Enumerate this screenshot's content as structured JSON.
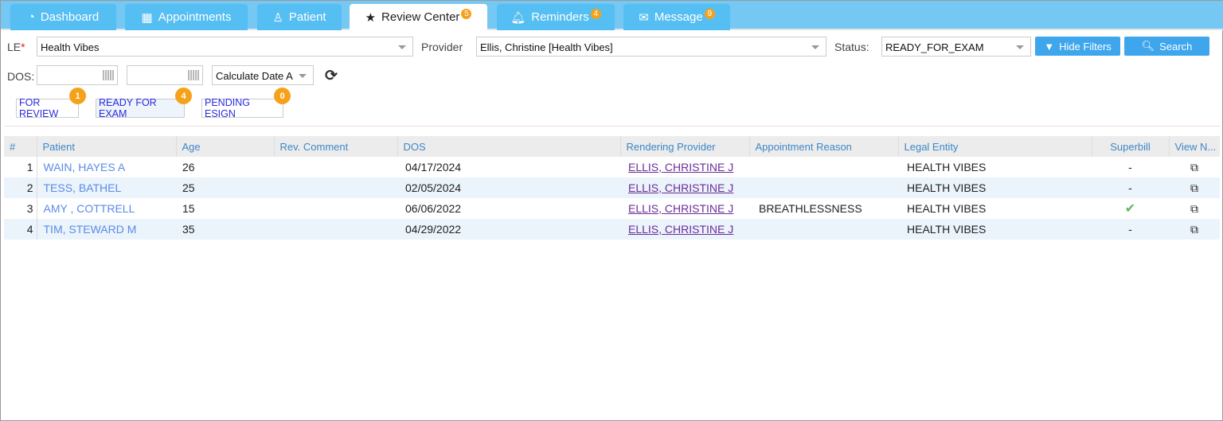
{
  "tabs": [
    {
      "label": "Dashboard",
      "icon": "dashboard-icon",
      "badge": null
    },
    {
      "label": "Appointments",
      "icon": "calendar-icon",
      "badge": null
    },
    {
      "label": "Patient",
      "icon": "user-icon",
      "badge": null
    },
    {
      "label": "Review Center",
      "icon": "star-icon",
      "badge": "5",
      "active": true
    },
    {
      "label": "Reminders",
      "icon": "bell-icon",
      "badge": "4"
    },
    {
      "label": "Message",
      "icon": "envelope-icon",
      "badge": "9"
    }
  ],
  "filters": {
    "le_label": "LE",
    "le_required": "*",
    "le_value": "Health Vibes",
    "provider_label": "Provider",
    "provider_value": "Ellis, Christine [Health Vibes]",
    "status_label": "Status:",
    "status_value": "READY_FOR_EXAM",
    "hide_filters": "Hide Filters",
    "search": "Search",
    "dos_label": "DOS:",
    "dos_from": "",
    "dos_to": "",
    "calc_date": "Calculate Date A:"
  },
  "status_pills": [
    {
      "label": "FOR REVIEW",
      "count": "1"
    },
    {
      "label": "READY FOR EXAM",
      "count": "4",
      "selected": true
    },
    {
      "label": "PENDING ESIGN",
      "count": "0"
    }
  ],
  "table": {
    "columns": [
      "#",
      "Patient",
      "Age",
      "Rev. Comment",
      "DOS",
      "Rendering Provider",
      "Appointment Reason",
      "Legal Entity",
      "Superbill",
      "View N..."
    ],
    "rows": [
      {
        "n": "1",
        "patient": "WAIN, HAYES A",
        "age": "26",
        "comment": "",
        "dos": "04/17/2024",
        "provider": "ELLIS, CHRISTINE J",
        "reason": "",
        "entity": "HEALTH VIBES",
        "superbill": "-"
      },
      {
        "n": "2",
        "patient": "TESS, BATHEL",
        "age": "25",
        "comment": "",
        "dos": "02/05/2024",
        "provider": "ELLIS, CHRISTINE J",
        "reason": "",
        "entity": "HEALTH VIBES",
        "superbill": "-"
      },
      {
        "n": "3",
        "patient": "AMY , COTTRELL",
        "age": "15",
        "comment": "",
        "dos": "06/06/2022",
        "provider": "ELLIS, CHRISTINE J",
        "reason": "BREATHLESSNESS",
        "entity": "HEALTH VIBES",
        "superbill": "✔"
      },
      {
        "n": "4",
        "patient": "TIM, STEWARD M",
        "age": "35",
        "comment": "",
        "dos": "04/29/2022",
        "provider": "ELLIS, CHRISTINE J",
        "reason": "",
        "entity": "HEALTH VIBES",
        "superbill": "-"
      }
    ]
  },
  "colors": {
    "tab_bar": "#74c8f3",
    "tab": "#55bef2",
    "button": "#3ea6ec",
    "badge": "#f5a21a",
    "link": "#5a8be8",
    "provider_link": "#6b2e9a"
  }
}
